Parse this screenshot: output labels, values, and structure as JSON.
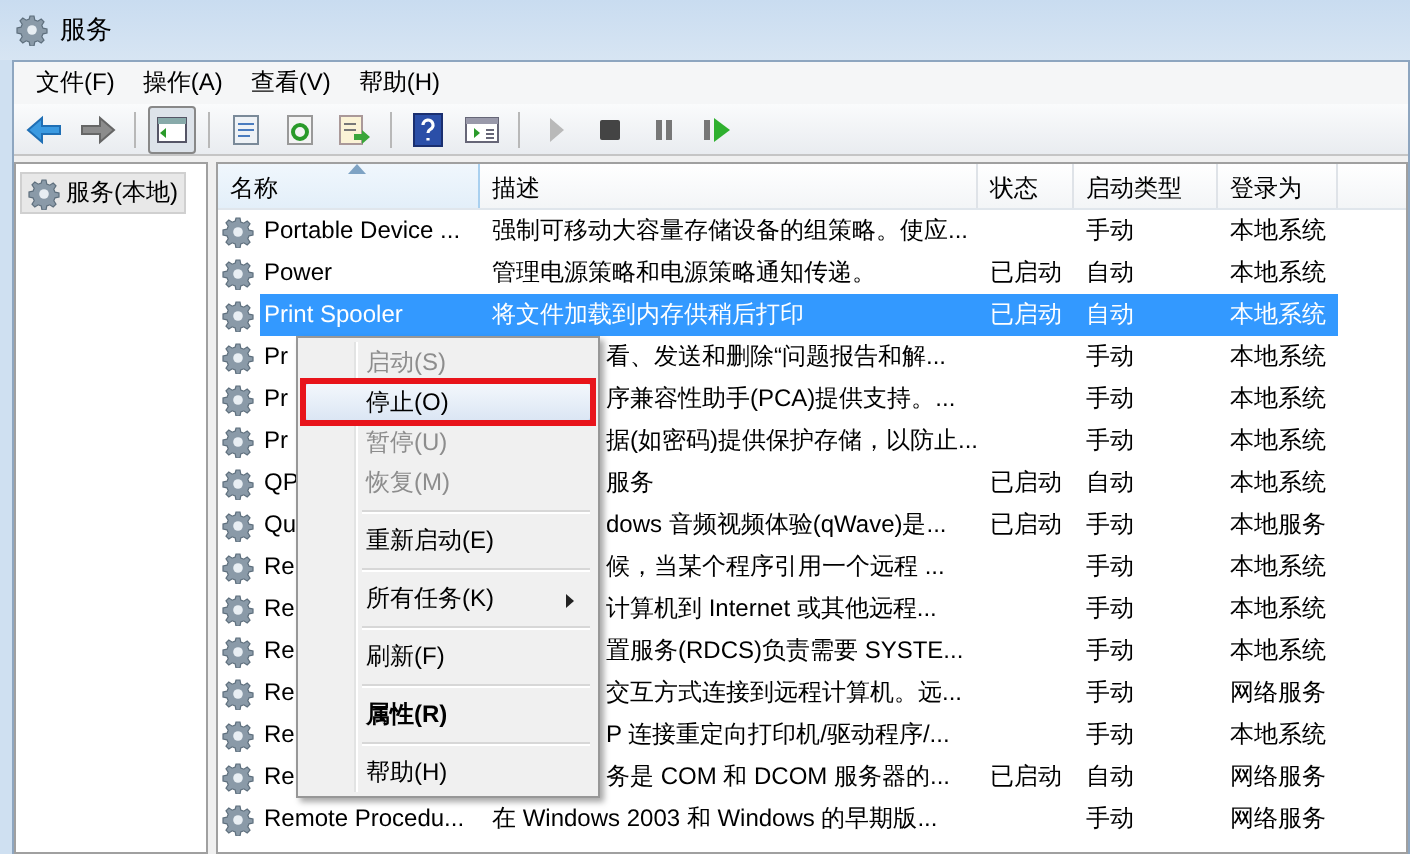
{
  "window": {
    "title": "服务"
  },
  "menu_bar": [
    {
      "label": "文件(F)"
    },
    {
      "label": "操作(A)"
    },
    {
      "label": "查看(V)"
    },
    {
      "label": "帮助(H)"
    }
  ],
  "toolbar": [
    {
      "kind": "back"
    },
    {
      "kind": "forward"
    },
    {
      "kind": "sep"
    },
    {
      "kind": "tree",
      "pressed": true
    },
    {
      "kind": "sep"
    },
    {
      "kind": "properties"
    },
    {
      "kind": "refresh"
    },
    {
      "kind": "export"
    },
    {
      "kind": "sep"
    },
    {
      "kind": "help"
    },
    {
      "kind": "view"
    },
    {
      "kind": "sep"
    },
    {
      "kind": "play"
    },
    {
      "kind": "stop"
    },
    {
      "kind": "pause"
    },
    {
      "kind": "restart"
    }
  ],
  "tree": {
    "items": [
      {
        "label": "服务(本地)"
      }
    ]
  },
  "table": {
    "columns": [
      {
        "label": "名称",
        "sorted": true
      },
      {
        "label": "描述",
        "sorted": false
      },
      {
        "label": "状态",
        "sorted": false
      },
      {
        "label": "启动类型",
        "sorted": false
      },
      {
        "label": "登录为",
        "sorted": false
      }
    ],
    "rows": [
      {
        "name": "Portable Device ...",
        "description": "强制可移动大容量存储设备的组策略。使应...",
        "status": "",
        "startup_type": "手动",
        "log_on_as": "本地系统",
        "selected": false
      },
      {
        "name": "Power",
        "description": "管理电源策略和电源策略通知传递。",
        "status": "已启动",
        "startup_type": "自动",
        "log_on_as": "本地系统",
        "selected": false
      },
      {
        "name": "Print Spooler",
        "description": "将文件加载到内存供稍后打印",
        "status": "已启动",
        "startup_type": "自动",
        "log_on_as": "本地系统",
        "selected": true
      },
      {
        "name": "Pr",
        "description": "看、发送和删除“问题报告和解...",
        "status": "",
        "startup_type": "手动",
        "log_on_as": "本地系统",
        "selected": false
      },
      {
        "name": "Pr",
        "description": "序兼容性助手(PCA)提供支持。...",
        "status": "",
        "startup_type": "手动",
        "log_on_as": "本地系统",
        "selected": false
      },
      {
        "name": "Pr",
        "description": "据(如密码)提供保护存储，以防止...",
        "status": "",
        "startup_type": "手动",
        "log_on_as": "本地系统",
        "selected": false
      },
      {
        "name": "QP",
        "description": "服务",
        "status": "已启动",
        "startup_type": "自动",
        "log_on_as": "本地系统",
        "selected": false
      },
      {
        "name": "Qu",
        "description": "dows 音频视频体验(qWave)是...",
        "status": "已启动",
        "startup_type": "手动",
        "log_on_as": "本地服务",
        "selected": false
      },
      {
        "name": "Re",
        "description": "候，当某个程序引用一个远程 ...",
        "status": "",
        "startup_type": "手动",
        "log_on_as": "本地系统",
        "selected": false
      },
      {
        "name": "Re",
        "description": "计算机到 Internet 或其他远程...",
        "status": "",
        "startup_type": "手动",
        "log_on_as": "本地系统",
        "selected": false
      },
      {
        "name": "Re",
        "description": "置服务(RDCS)负责需要 SYSTE...",
        "status": "",
        "startup_type": "手动",
        "log_on_as": "本地系统",
        "selected": false
      },
      {
        "name": "Re",
        "description": "交互方式连接到远程计算机。远...",
        "status": "",
        "startup_type": "手动",
        "log_on_as": "网络服务",
        "selected": false
      },
      {
        "name": "Re",
        "description": "P 连接重定向打印机/驱动程序/...",
        "status": "",
        "startup_type": "手动",
        "log_on_as": "本地系统",
        "selected": false
      },
      {
        "name": "Re",
        "description": "务是 COM 和 DCOM 服务器的...",
        "status": "已启动",
        "startup_type": "自动",
        "log_on_as": "网络服务",
        "selected": false
      },
      {
        "name": "Remote Procedu...",
        "description": "在 Windows 2003 和 Windows 的早期版...",
        "status": "",
        "startup_type": "手动",
        "log_on_as": "网络服务",
        "selected": false
      }
    ]
  },
  "context_menu": [
    {
      "kind": "item",
      "label": "启动(S)",
      "disabled": true,
      "highlighted": false,
      "bold": false,
      "submenu": false
    },
    {
      "kind": "item",
      "label": "停止(O)",
      "disabled": false,
      "highlighted": true,
      "bold": false,
      "submenu": false
    },
    {
      "kind": "item",
      "label": "暂停(U)",
      "disabled": true,
      "highlighted": false,
      "bold": false,
      "submenu": false
    },
    {
      "kind": "item",
      "label": "恢复(M)",
      "disabled": true,
      "highlighted": false,
      "bold": false,
      "submenu": false
    },
    {
      "kind": "separator"
    },
    {
      "kind": "item",
      "label": "重新启动(E)",
      "disabled": false,
      "highlighted": false,
      "bold": false,
      "submenu": false
    },
    {
      "kind": "separator"
    },
    {
      "kind": "item",
      "label": "所有任务(K)",
      "disabled": false,
      "highlighted": false,
      "bold": false,
      "submenu": true
    },
    {
      "kind": "separator"
    },
    {
      "kind": "item",
      "label": "刷新(F)",
      "disabled": false,
      "highlighted": false,
      "bold": false,
      "submenu": false
    },
    {
      "kind": "separator"
    },
    {
      "kind": "item",
      "label": "属性(R)",
      "disabled": false,
      "highlighted": false,
      "bold": true,
      "submenu": false
    },
    {
      "kind": "separator"
    },
    {
      "kind": "item",
      "label": "帮助(H)",
      "disabled": false,
      "highlighted": false,
      "bold": false,
      "submenu": false
    }
  ]
}
